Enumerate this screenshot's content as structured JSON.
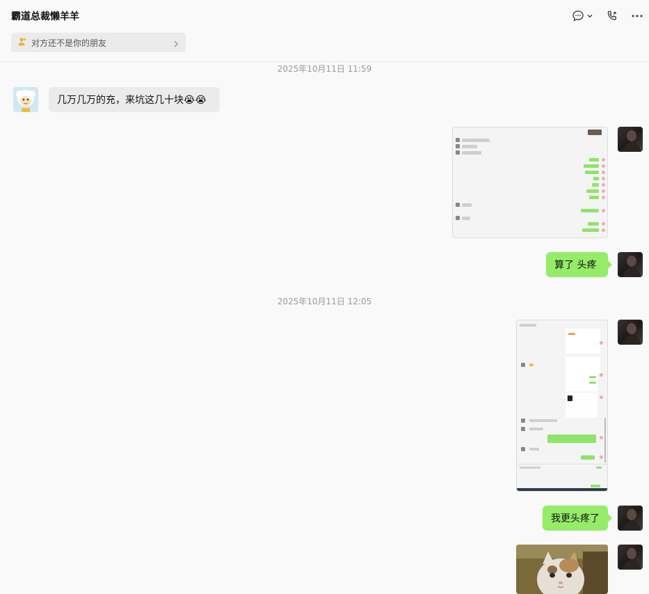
{
  "header": {
    "title": "霸道总裁懒羊羊",
    "notice_text": "对方还不是你的朋友",
    "icons": [
      "chat-bubble-icon",
      "chevron-down-icon",
      "phone-call-icon",
      "more-icon"
    ]
  },
  "messages": {
    "ts1": "2025年10月11日 11:59",
    "friend_msg": "几万几万的充，来坑这几十块😭😭",
    "my_msg1": "算了  头疼",
    "ts2": "2025年10月11日 12:05",
    "my_msg2": "我更头疼了"
  },
  "colors": {
    "background": "#f9f9fa",
    "incoming_bubble": "#ebebeb",
    "outgoing_bubble": "#95ec69",
    "timestamp": "#9a9a9a"
  }
}
